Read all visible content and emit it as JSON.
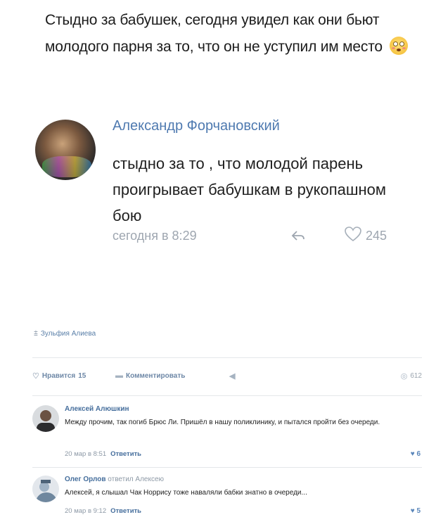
{
  "post": {
    "text": "Стыдно за бабушек, сегодня увидел как они бьют молодого парня за то, что он не уступил им место"
  },
  "quoted_comment": {
    "author": "Александр Форчановский",
    "text": "стыдно за то , что молодой парень проигрывает бабушкам в рукопашном бою",
    "time": "сегодня в 8:29",
    "likes": "245"
  },
  "mention": {
    "name": "Зульфия Алиева"
  },
  "actions": {
    "like_label": "Нравится",
    "like_count": "15",
    "comment_label": "Комментировать",
    "views": "612"
  },
  "comments": [
    {
      "author": "Алексей Алюшкин",
      "text": "Между прочим, так погиб Брюс Ли. Пришёл в нашу поликлинику, и пытался пройти без очереди.",
      "time": "20 мар в 8:51",
      "reply": "Ответить",
      "likes": "6"
    },
    {
      "author": "Олег Орлов",
      "replied_to": "ответил Алексею",
      "text": "Алексей, я слышал Чак Норрису тоже наваляли бабки знатно в очереди...",
      "time": "20 мар в 9:12",
      "reply": "Ответить",
      "likes": "5"
    }
  ],
  "icons": {
    "reply": "reply-arrow-icon",
    "heart": "heart-icon",
    "eye": "eye-icon",
    "comment": "comment-icon",
    "share": "megaphone-icon"
  },
  "colors": {
    "link": "#4f7ab0",
    "meta": "#9ea6b0",
    "like": "#5a86ba"
  }
}
